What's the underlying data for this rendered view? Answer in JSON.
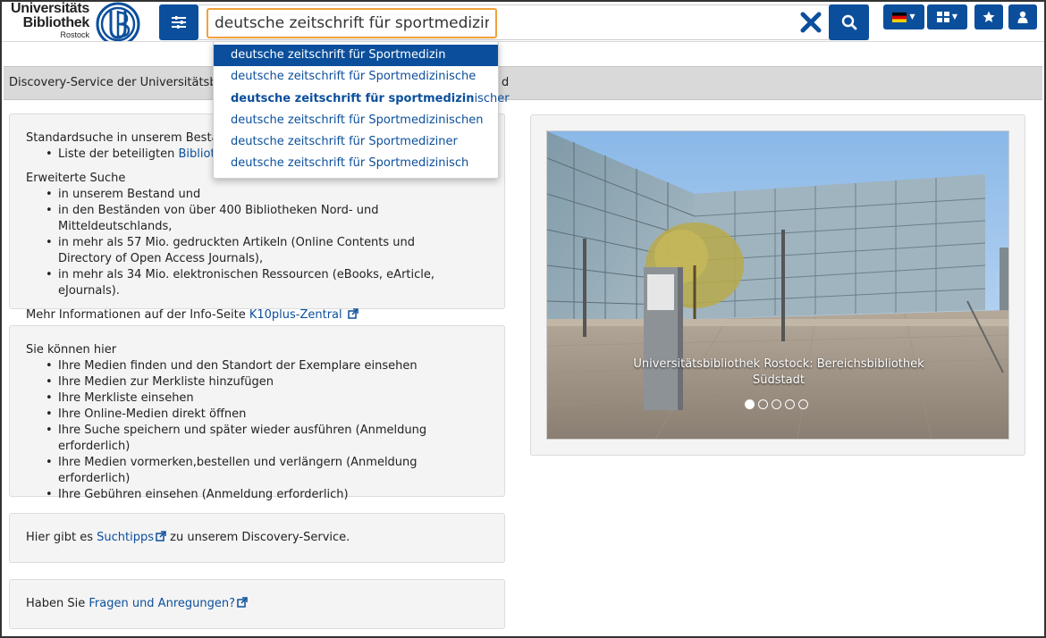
{
  "header": {
    "logo": {
      "line1": "Universitäts",
      "line2": "Bibliothek",
      "line3": "Rostock"
    },
    "search": {
      "value": "deutsche zeitschrift für sportmedizin"
    },
    "icons": [
      "sliders-icon",
      "close-icon",
      "search-icon",
      "flag-de-icon",
      "grid-icon",
      "star-icon",
      "user-icon"
    ]
  },
  "suggestions": [
    {
      "normal": "deutsche zeitschrift für Sportmedizin",
      "bold": "",
      "rest": ""
    },
    {
      "normal": "deutsche zeitschrift für Sportmedizinische",
      "bold": "",
      "rest": ""
    },
    {
      "normal": "",
      "bold": "deutsche zeitschrift für sportmedizin",
      "rest": "ischer"
    },
    {
      "normal": "deutsche zeitschrift für Sportmedizinischen",
      "bold": "",
      "rest": ""
    },
    {
      "normal": "deutsche zeitschrift für Sportmediziner",
      "bold": "",
      "rest": ""
    },
    {
      "normal": "deutsche zeitschrift für Sportmedizinisch",
      "bold": "",
      "rest": ""
    }
  ],
  "infobar": {
    "text": "Discovery-Service der Universitätsbibl",
    "tail": "d"
  },
  "panel1": {
    "intro": "Standardsuche in unserem Bestand",
    "list1_prefix": "Liste der beteiligten ",
    "list1_link": "Biblioth",
    "ext_heading": "Erweiterte Suche",
    "ext_items": [
      "in unserem Bestand und",
      "in den Beständen von über 400 Bibliotheken Nord- und Mitteldeutschlands,",
      "in mehr als 57 Mio. gedruckten Artikeln (Online Contents und Directory of Open Access Journals),",
      "in mehr als 34 Mio. elektronischen Ressourcen (eBooks, eArticle, eJournals)."
    ],
    "more_prefix": "Mehr Informationen auf der Info-Seite ",
    "more_link": "K10plus-Zentral"
  },
  "panel2": {
    "heading": "Sie können hier",
    "items": [
      "Ihre Medien finden und den Standort der Exemplare einsehen",
      "Ihre Medien zur Merkliste hinzufügen",
      "Ihre Merkliste einsehen",
      "Ihre Online-Medien direkt öffnen",
      "Ihre Suche speichern und später wieder ausführen (Anmeldung erforderlich)",
      "Ihre Medien vormerken,bestellen und verlängern (Anmeldung erforderlich)",
      "Ihre Gebühren einsehen (Anmeldung erforderlich)"
    ]
  },
  "panel3": {
    "prefix": "Hier gibt es ",
    "link": "Suchtipps",
    "suffix": " zu unserem Discovery-Service."
  },
  "panel4": {
    "prefix": "Haben Sie ",
    "link": "Fragen und Anregungen?"
  },
  "carousel": {
    "caption_line1": "Universitätsbibliothek Rostock: Bereichsbibliothek",
    "caption_line2": "Südstadt",
    "slide_count": 5,
    "active_slide": 1
  },
  "colors": {
    "primary": "#0b4f9c",
    "input_border": "#f0a23a",
    "infobar": "#d9d9d9",
    "panel": "#f4f4f4"
  }
}
